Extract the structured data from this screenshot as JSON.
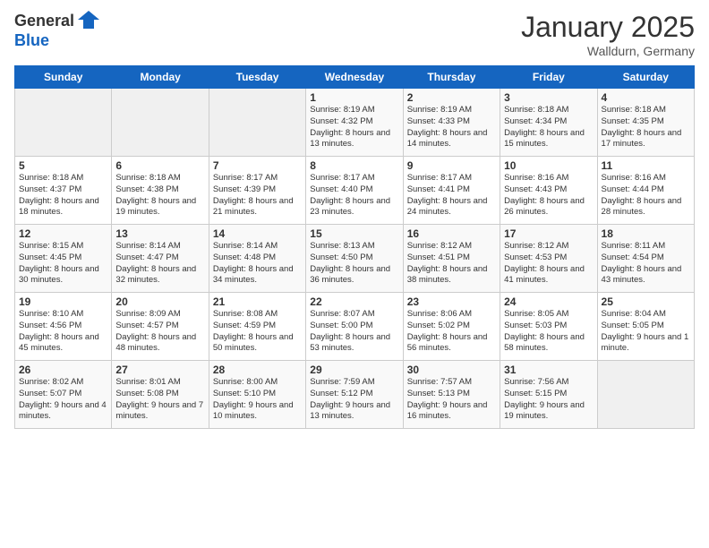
{
  "header": {
    "logo_line1": "General",
    "logo_line2": "Blue",
    "month": "January 2025",
    "location": "Walldurn, Germany"
  },
  "weekdays": [
    "Sunday",
    "Monday",
    "Tuesday",
    "Wednesday",
    "Thursday",
    "Friday",
    "Saturday"
  ],
  "weeks": [
    [
      {
        "day": "",
        "sunrise": "",
        "sunset": "",
        "daylight": "",
        "empty": true
      },
      {
        "day": "",
        "sunrise": "",
        "sunset": "",
        "daylight": "",
        "empty": true
      },
      {
        "day": "",
        "sunrise": "",
        "sunset": "",
        "daylight": "",
        "empty": true
      },
      {
        "day": "1",
        "sunrise": "Sunrise: 8:19 AM",
        "sunset": "Sunset: 4:32 PM",
        "daylight": "Daylight: 8 hours and 13 minutes."
      },
      {
        "day": "2",
        "sunrise": "Sunrise: 8:19 AM",
        "sunset": "Sunset: 4:33 PM",
        "daylight": "Daylight: 8 hours and 14 minutes."
      },
      {
        "day": "3",
        "sunrise": "Sunrise: 8:18 AM",
        "sunset": "Sunset: 4:34 PM",
        "daylight": "Daylight: 8 hours and 15 minutes."
      },
      {
        "day": "4",
        "sunrise": "Sunrise: 8:18 AM",
        "sunset": "Sunset: 4:35 PM",
        "daylight": "Daylight: 8 hours and 17 minutes."
      }
    ],
    [
      {
        "day": "5",
        "sunrise": "Sunrise: 8:18 AM",
        "sunset": "Sunset: 4:37 PM",
        "daylight": "Daylight: 8 hours and 18 minutes."
      },
      {
        "day": "6",
        "sunrise": "Sunrise: 8:18 AM",
        "sunset": "Sunset: 4:38 PM",
        "daylight": "Daylight: 8 hours and 19 minutes."
      },
      {
        "day": "7",
        "sunrise": "Sunrise: 8:17 AM",
        "sunset": "Sunset: 4:39 PM",
        "daylight": "Daylight: 8 hours and 21 minutes."
      },
      {
        "day": "8",
        "sunrise": "Sunrise: 8:17 AM",
        "sunset": "Sunset: 4:40 PM",
        "daylight": "Daylight: 8 hours and 23 minutes."
      },
      {
        "day": "9",
        "sunrise": "Sunrise: 8:17 AM",
        "sunset": "Sunset: 4:41 PM",
        "daylight": "Daylight: 8 hours and 24 minutes."
      },
      {
        "day": "10",
        "sunrise": "Sunrise: 8:16 AM",
        "sunset": "Sunset: 4:43 PM",
        "daylight": "Daylight: 8 hours and 26 minutes."
      },
      {
        "day": "11",
        "sunrise": "Sunrise: 8:16 AM",
        "sunset": "Sunset: 4:44 PM",
        "daylight": "Daylight: 8 hours and 28 minutes."
      }
    ],
    [
      {
        "day": "12",
        "sunrise": "Sunrise: 8:15 AM",
        "sunset": "Sunset: 4:45 PM",
        "daylight": "Daylight: 8 hours and 30 minutes."
      },
      {
        "day": "13",
        "sunrise": "Sunrise: 8:14 AM",
        "sunset": "Sunset: 4:47 PM",
        "daylight": "Daylight: 8 hours and 32 minutes."
      },
      {
        "day": "14",
        "sunrise": "Sunrise: 8:14 AM",
        "sunset": "Sunset: 4:48 PM",
        "daylight": "Daylight: 8 hours and 34 minutes."
      },
      {
        "day": "15",
        "sunrise": "Sunrise: 8:13 AM",
        "sunset": "Sunset: 4:50 PM",
        "daylight": "Daylight: 8 hours and 36 minutes."
      },
      {
        "day": "16",
        "sunrise": "Sunrise: 8:12 AM",
        "sunset": "Sunset: 4:51 PM",
        "daylight": "Daylight: 8 hours and 38 minutes."
      },
      {
        "day": "17",
        "sunrise": "Sunrise: 8:12 AM",
        "sunset": "Sunset: 4:53 PM",
        "daylight": "Daylight: 8 hours and 41 minutes."
      },
      {
        "day": "18",
        "sunrise": "Sunrise: 8:11 AM",
        "sunset": "Sunset: 4:54 PM",
        "daylight": "Daylight: 8 hours and 43 minutes."
      }
    ],
    [
      {
        "day": "19",
        "sunrise": "Sunrise: 8:10 AM",
        "sunset": "Sunset: 4:56 PM",
        "daylight": "Daylight: 8 hours and 45 minutes."
      },
      {
        "day": "20",
        "sunrise": "Sunrise: 8:09 AM",
        "sunset": "Sunset: 4:57 PM",
        "daylight": "Daylight: 8 hours and 48 minutes."
      },
      {
        "day": "21",
        "sunrise": "Sunrise: 8:08 AM",
        "sunset": "Sunset: 4:59 PM",
        "daylight": "Daylight: 8 hours and 50 minutes."
      },
      {
        "day": "22",
        "sunrise": "Sunrise: 8:07 AM",
        "sunset": "Sunset: 5:00 PM",
        "daylight": "Daylight: 8 hours and 53 minutes."
      },
      {
        "day": "23",
        "sunrise": "Sunrise: 8:06 AM",
        "sunset": "Sunset: 5:02 PM",
        "daylight": "Daylight: 8 hours and 56 minutes."
      },
      {
        "day": "24",
        "sunrise": "Sunrise: 8:05 AM",
        "sunset": "Sunset: 5:03 PM",
        "daylight": "Daylight: 8 hours and 58 minutes."
      },
      {
        "day": "25",
        "sunrise": "Sunrise: 8:04 AM",
        "sunset": "Sunset: 5:05 PM",
        "daylight": "Daylight: 9 hours and 1 minute."
      }
    ],
    [
      {
        "day": "26",
        "sunrise": "Sunrise: 8:02 AM",
        "sunset": "Sunset: 5:07 PM",
        "daylight": "Daylight: 9 hours and 4 minutes."
      },
      {
        "day": "27",
        "sunrise": "Sunrise: 8:01 AM",
        "sunset": "Sunset: 5:08 PM",
        "daylight": "Daylight: 9 hours and 7 minutes."
      },
      {
        "day": "28",
        "sunrise": "Sunrise: 8:00 AM",
        "sunset": "Sunset: 5:10 PM",
        "daylight": "Daylight: 9 hours and 10 minutes."
      },
      {
        "day": "29",
        "sunrise": "Sunrise: 7:59 AM",
        "sunset": "Sunset: 5:12 PM",
        "daylight": "Daylight: 9 hours and 13 minutes."
      },
      {
        "day": "30",
        "sunrise": "Sunrise: 7:57 AM",
        "sunset": "Sunset: 5:13 PM",
        "daylight": "Daylight: 9 hours and 16 minutes."
      },
      {
        "day": "31",
        "sunrise": "Sunrise: 7:56 AM",
        "sunset": "Sunset: 5:15 PM",
        "daylight": "Daylight: 9 hours and 19 minutes."
      },
      {
        "day": "",
        "sunrise": "",
        "sunset": "",
        "daylight": "",
        "empty": true
      }
    ]
  ]
}
